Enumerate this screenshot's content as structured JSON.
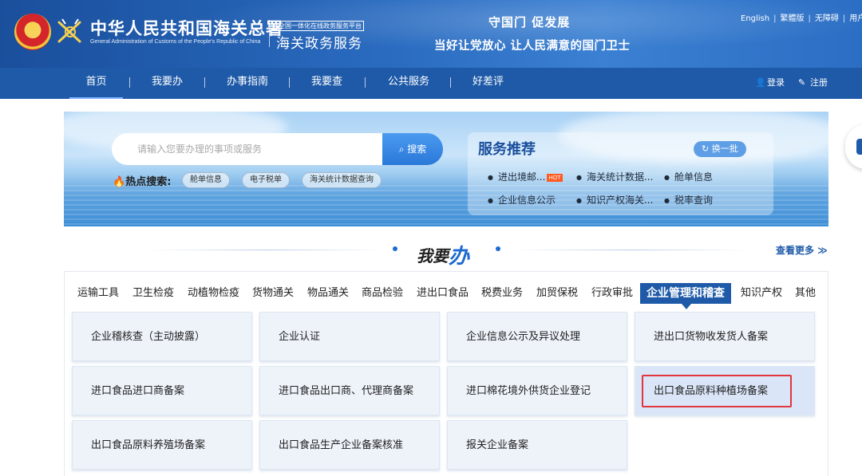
{
  "header": {
    "org_title": "中华人民共和国海关总署",
    "org_subtitle": "General Administration of Customs of the People's Republic of China",
    "platform_tag": "全国一体化在线政务服务平台",
    "platform_name": "海关政务服务",
    "slogan_line1": "守国门  促发展",
    "slogan_line2": "当好让党放心  让人民满意的国门卫士",
    "top_links": [
      "English",
      "繁體版",
      "无障碍",
      "用户"
    ]
  },
  "nav": {
    "items": [
      "首页",
      "我要办",
      "办事指南",
      "我要查",
      "公共服务",
      "好差评"
    ],
    "active": "首页",
    "login": "登录",
    "register": "注册"
  },
  "banner": {
    "search_placeholder": "请输入您要办理的事项或服务",
    "search_button": "搜索",
    "hot_label": "热点搜索:",
    "hot_tags": [
      "舱单信息",
      "电子税单",
      "海关统计数据查询"
    ],
    "recommend_title": "服务推荐",
    "refresh_label": "换一批",
    "recommend_items": [
      "进出境邮...",
      "海关统计数据...",
      "舱单信息",
      "企业信息公示",
      "知识产权海关...",
      "税率查询"
    ],
    "hot_badge": "HOT"
  },
  "section": {
    "title_prefix": "我要",
    "title_big": "办",
    "more_label": "查看更多 ≫"
  },
  "categories": [
    "运输工具",
    "卫生检疫",
    "动植物检疫",
    "货物通关",
    "物品通关",
    "商品检验",
    "进出口食品",
    "税费业务",
    "加贸保税",
    "行政审批",
    "企业管理和稽查",
    "知识产权",
    "其他"
  ],
  "active_category": "企业管理和稽查",
  "services": [
    "企业稽核查（主动披露）",
    "企业认证",
    "企业信息公示及异议处理",
    "进出口货物收发货人备案",
    "进口食品进口商备案",
    "进口食品出口商、代理商备案",
    "进口棉花境外供货企业登记",
    "出口食品原料种植场备案",
    "出口食品原料养殖场备案",
    "出口食品生产企业备案核准",
    "报关企业备案"
  ],
  "selected_service": "出口食品原料种植场备案",
  "colors": {
    "brand": "#1e5aa8",
    "highlight": "#e0363c",
    "hot": "#ff5a1f"
  }
}
